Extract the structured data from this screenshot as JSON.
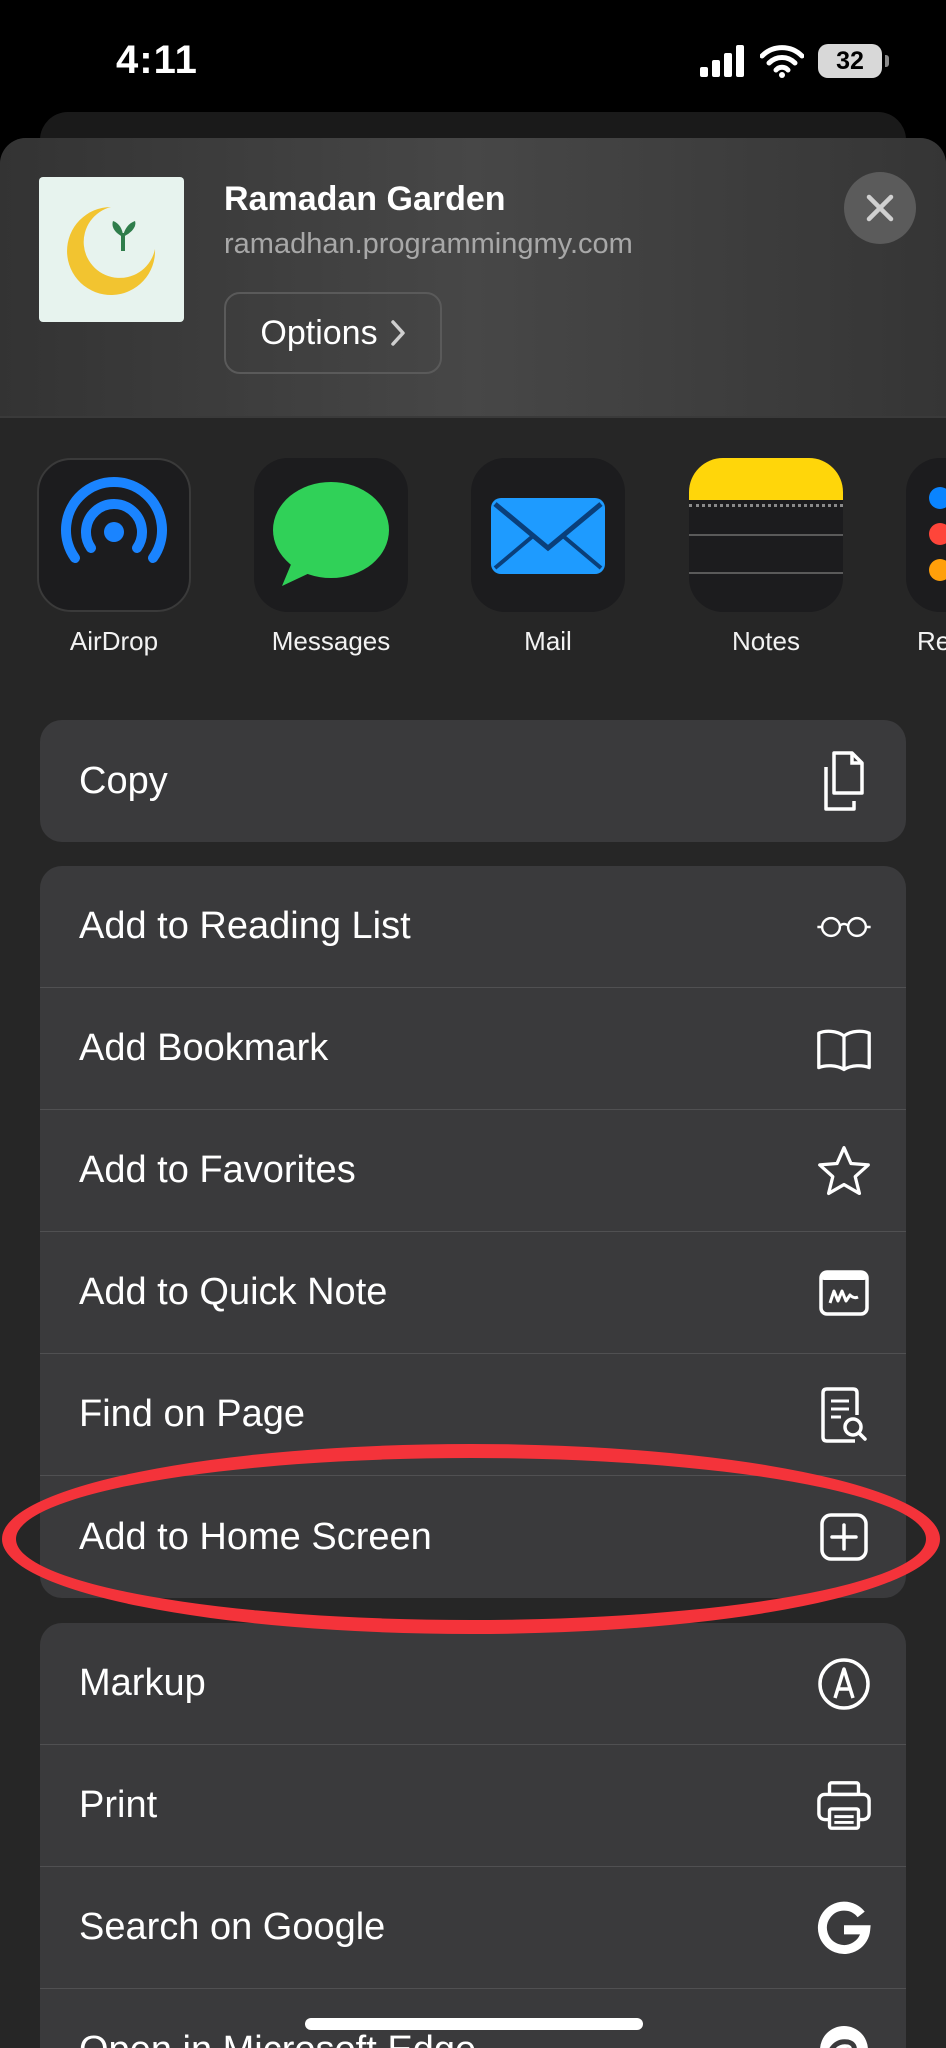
{
  "status_bar": {
    "time": "4:11",
    "battery": "32"
  },
  "header": {
    "title": "Ramadan Garden",
    "url": "ramadhan.programmingmy.com",
    "options_label": "Options"
  },
  "share_apps": [
    {
      "label": "AirDrop",
      "icon": "airdrop-icon"
    },
    {
      "label": "Messages",
      "icon": "messages-icon"
    },
    {
      "label": "Mail",
      "icon": "mail-icon"
    },
    {
      "label": "Notes",
      "icon": "notes-icon"
    },
    {
      "label": "Re",
      "icon": "reminders-icon"
    }
  ],
  "actions": {
    "copy": {
      "label": "Copy",
      "icon": "copy-icon"
    },
    "group2": [
      {
        "label": "Add to Reading List",
        "icon": "glasses-icon"
      },
      {
        "label": "Add Bookmark",
        "icon": "book-icon"
      },
      {
        "label": "Add to Favorites",
        "icon": "star-icon"
      },
      {
        "label": "Add to Quick Note",
        "icon": "quick-note-icon"
      },
      {
        "label": "Find on Page",
        "icon": "find-on-page-icon"
      },
      {
        "label": "Add to Home Screen",
        "icon": "add-square-icon"
      }
    ],
    "group3": [
      {
        "label": "Markup",
        "icon": "markup-icon"
      },
      {
        "label": "Print",
        "icon": "printer-icon"
      },
      {
        "label": "Search on Google",
        "icon": "google-icon"
      },
      {
        "label": "Open in Microsoft Edge",
        "icon": "edge-icon"
      }
    ]
  },
  "colors": {
    "highlight": "#f4333a",
    "sheet": "#262626",
    "row_bg": "#3a3a3c"
  }
}
